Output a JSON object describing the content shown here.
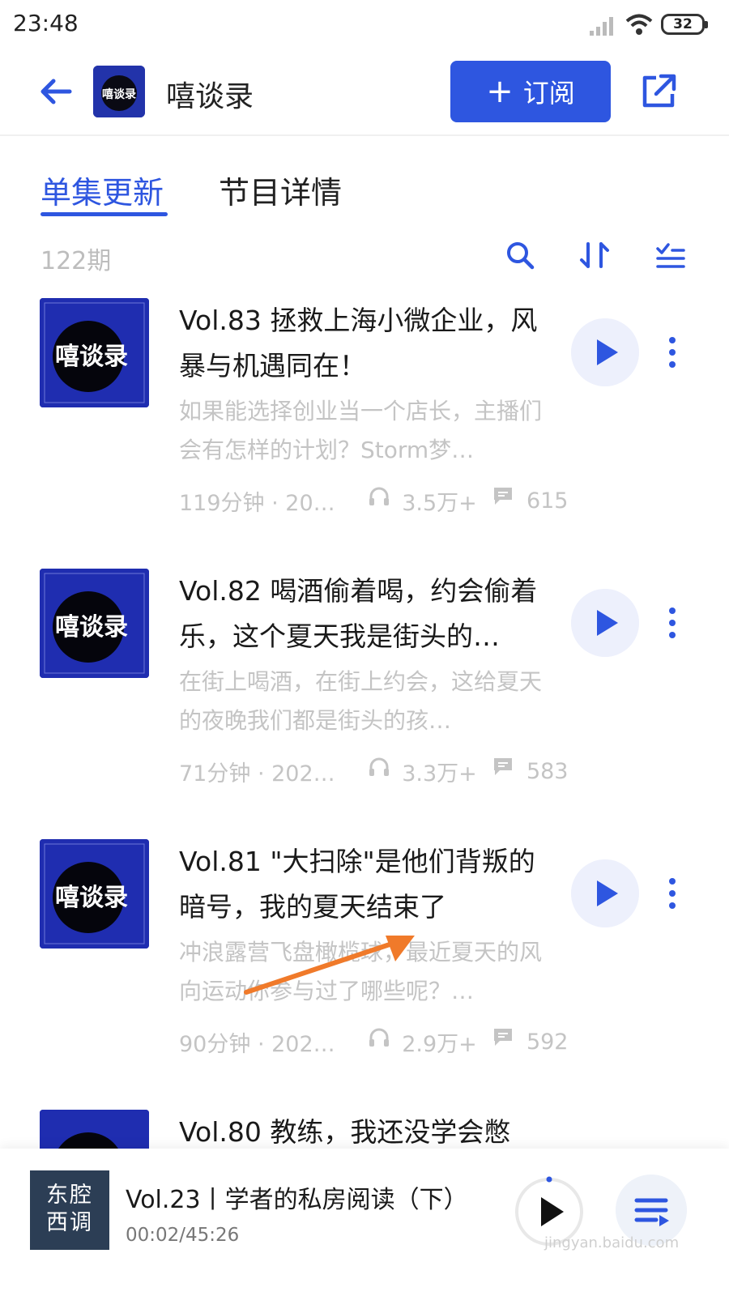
{
  "status_bar": {
    "time": "23:48",
    "battery": "32"
  },
  "header": {
    "logo_text": "嘻谈录",
    "title": "嘻谈录",
    "subscribe_label": "订阅",
    "subscribe_plus": "+"
  },
  "tabs": [
    {
      "label": "单集更新",
      "active": true
    },
    {
      "label": "节目详情",
      "active": false
    }
  ],
  "list": {
    "count": "122期"
  },
  "episodes": [
    {
      "title": "Vol.83 拯救上海小微企业，风暴与机遇同在！",
      "desc": "如果能选择创业当一个店长，主播们会有怎样的计划？Storm梦…",
      "duration": "119分钟 · 202…",
      "plays": "3.5万+",
      "comments": "615"
    },
    {
      "title": "Vol.82 喝酒偷着喝，约会偷着乐，这个夏天我是街头的…",
      "desc": "在街上喝酒，在街上约会，这给夏天的夜晚我们都是街头的孩…",
      "duration": "71分钟 · 2022…",
      "plays": "3.3万+",
      "comments": "583"
    },
    {
      "title": "Vol.81 \"大扫除\"是他们背叛的暗号，我的夏天结束了",
      "desc": "冲浪露营飞盘橄榄球，最近夏天的风向运动你参与过了哪些呢？…",
      "duration": "90分钟 · 2022…",
      "plays": "2.9万+",
      "comments": "592"
    },
    {
      "title": "Vol.80 教练，我还没学会憋",
      "desc": "",
      "duration": "",
      "plays": "",
      "comments": ""
    }
  ],
  "player": {
    "cover_line1": "东腔",
    "cover_line2": "西调",
    "title": "Vol.23丨学者的私房阅读（下）",
    "time": "00:02/45:26"
  },
  "watermark": "jingyan.baidu.com",
  "colors": {
    "accent": "#2e56e0",
    "muted": "#c4c4c4",
    "cover_blue": "#1f2db0",
    "annotation_arrow": "#f07a2a"
  }
}
